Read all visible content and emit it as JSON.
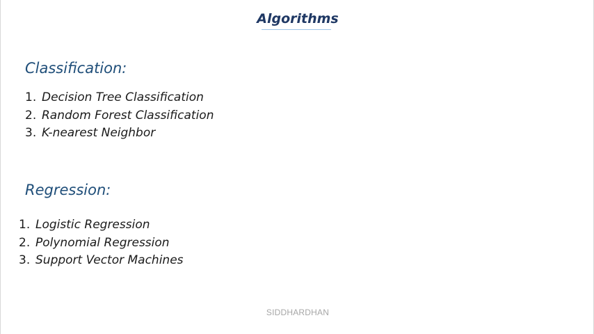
{
  "slide": {
    "title": "Algorithms",
    "footer": "SIDDHARDHAN"
  },
  "classification": {
    "heading": "Classification:",
    "items": [
      {
        "number": "1.",
        "label": "Decision Tree Classification"
      },
      {
        "number": "2.",
        "label": "Random Forest Classification"
      },
      {
        "number": "3.",
        "label": "K-nearest Neighbor"
      }
    ]
  },
  "regression": {
    "heading": "Regression:",
    "items": [
      {
        "number": "1.",
        "label": "Logistic Regression"
      },
      {
        "number": "2.",
        "label": "Polynomial Regression"
      },
      {
        "number": "3.",
        "label": "Support Vector Machines"
      }
    ]
  },
  "colors": {
    "title": "#1f3864",
    "heading": "#1f4e79",
    "body_text": "#1a1a1a",
    "footer": "#a6a6a6"
  }
}
